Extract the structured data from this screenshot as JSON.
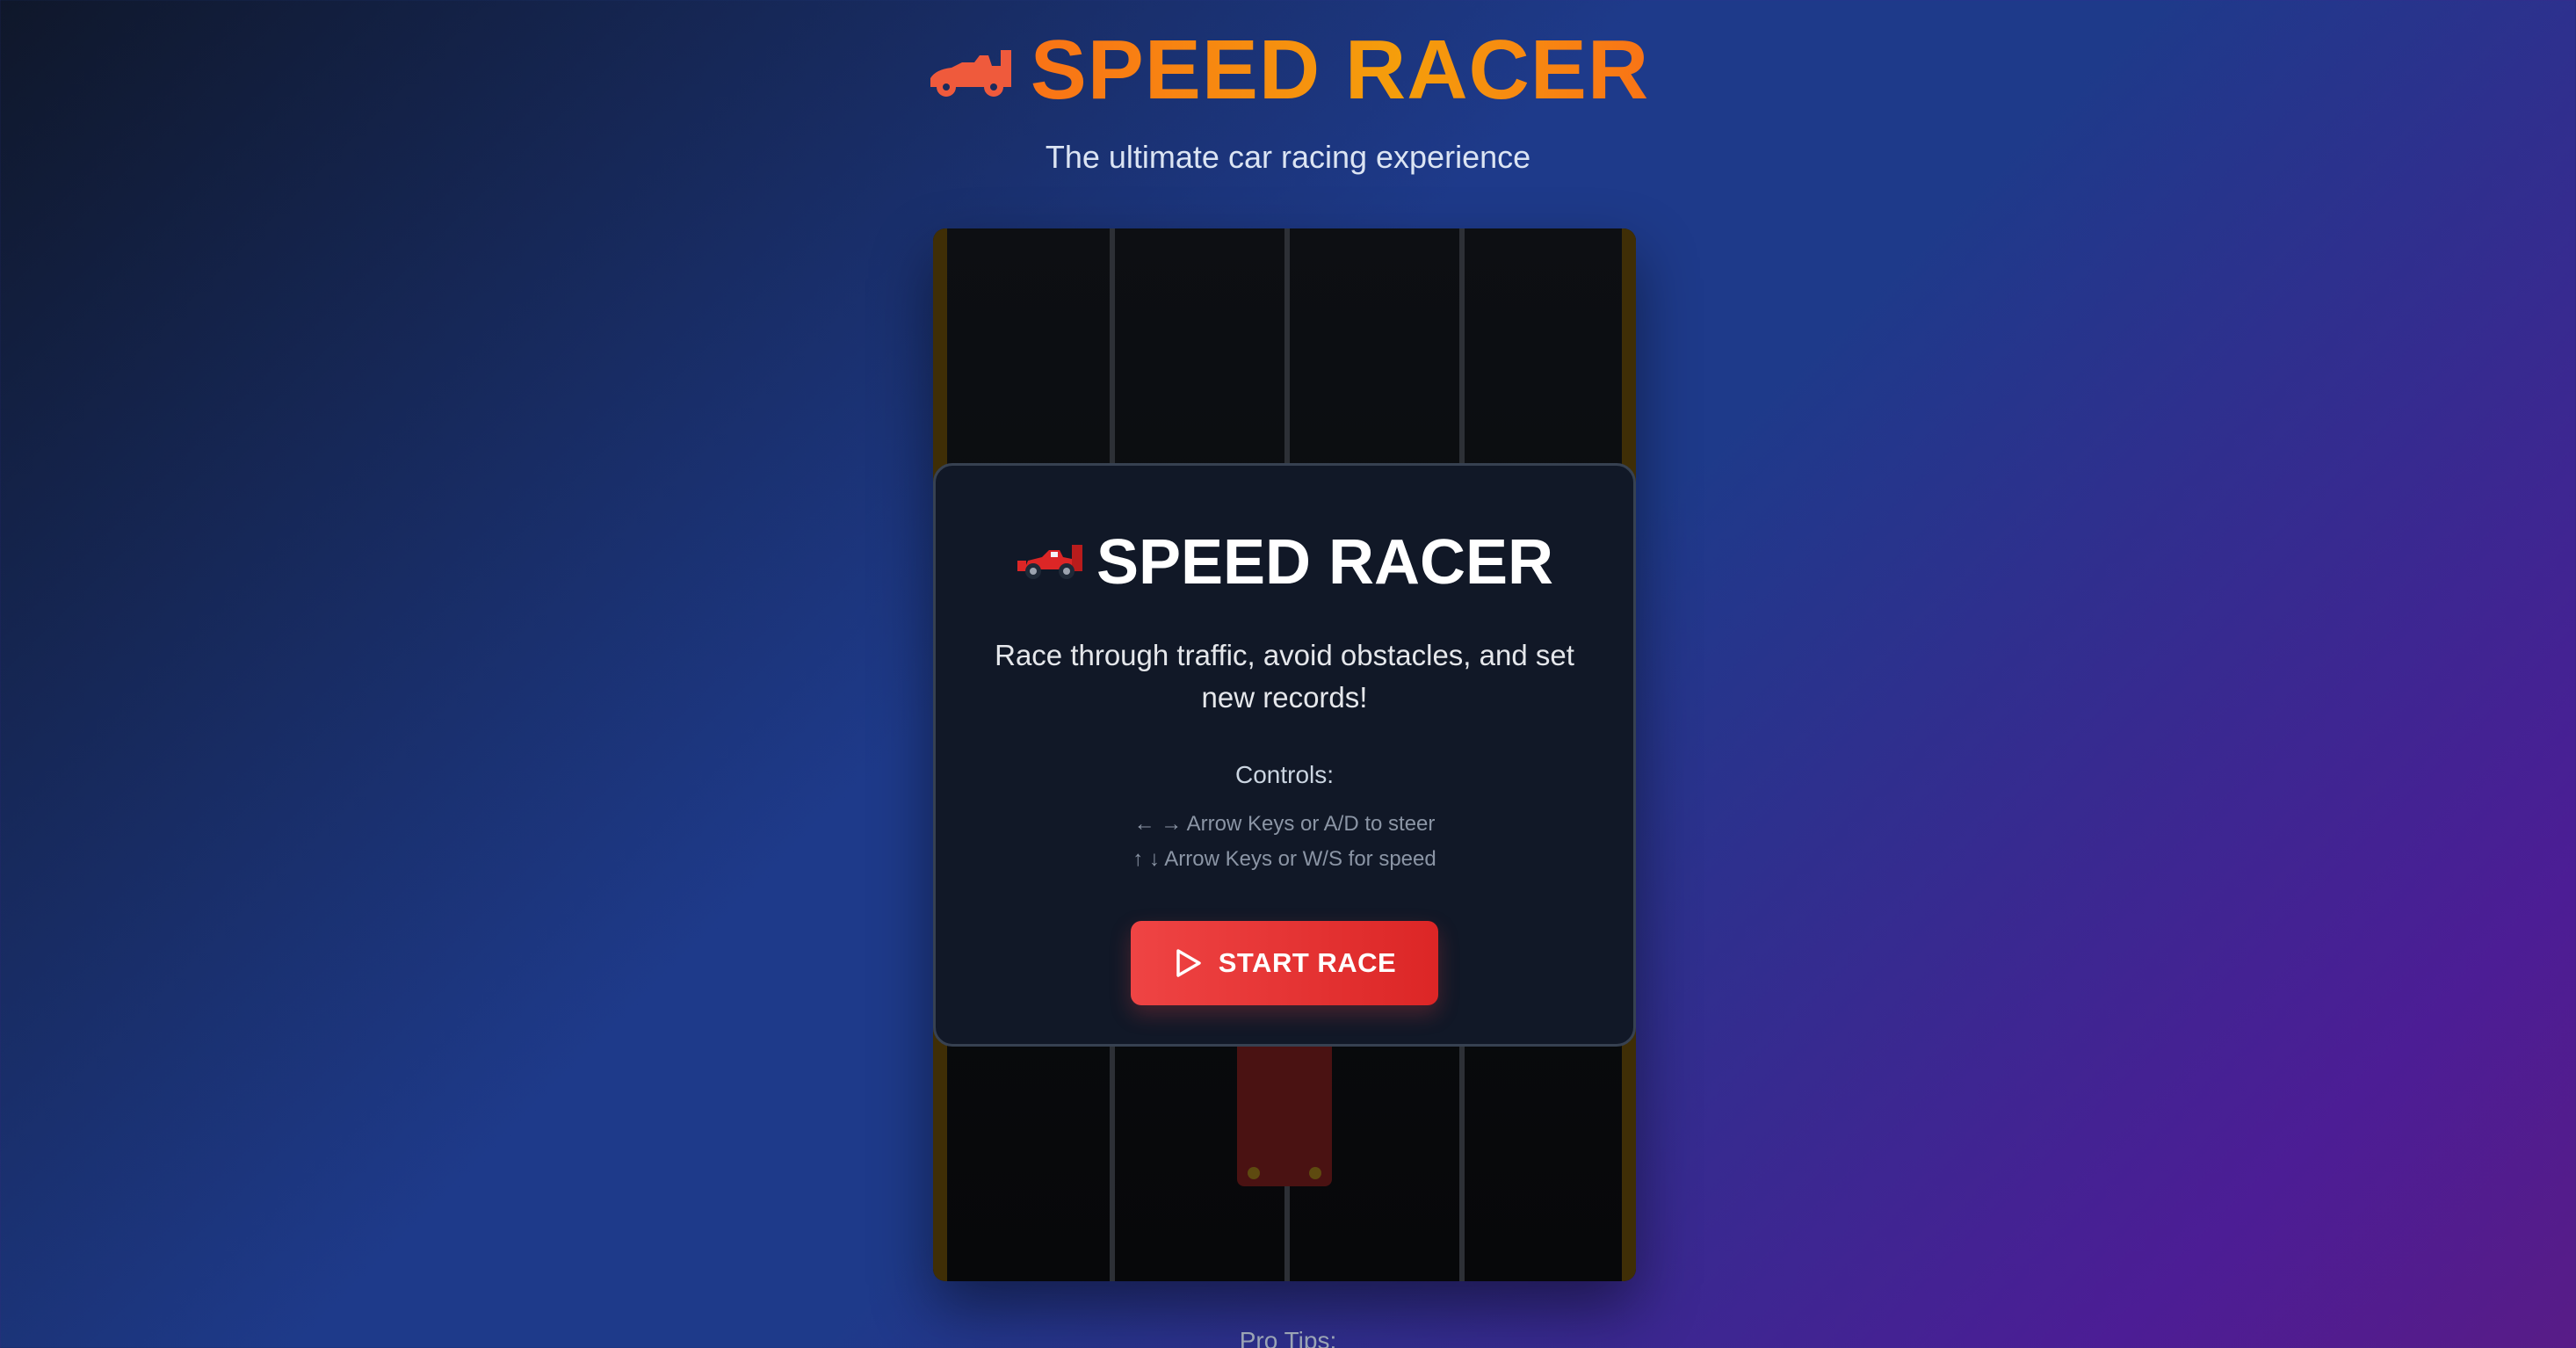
{
  "header": {
    "icon": "race-car-icon",
    "title": "SPEED RACER",
    "subtitle": "The ultimate car racing experience"
  },
  "menu": {
    "icon": "race-car-icon",
    "title": "SPEED RACER",
    "description": "Race through traffic, avoid obstacles, and set new records!",
    "controls_label": "Controls:",
    "controls": [
      "← → Arrow Keys or A/D to steer",
      "↑ ↓ Arrow Keys or W/S for speed"
    ],
    "start_button": {
      "icon": "play-icon",
      "label": "START RACE"
    }
  },
  "footer": {
    "pro_tips_label": "Pro Tips:"
  },
  "colors": {
    "title_gradient_start": "#f97316",
    "title_gradient_end": "#f59e0b",
    "button": "#ef4444",
    "panel_bg": "#111827",
    "track_edge": "#3f2e06",
    "player_car": "#4a1212"
  }
}
